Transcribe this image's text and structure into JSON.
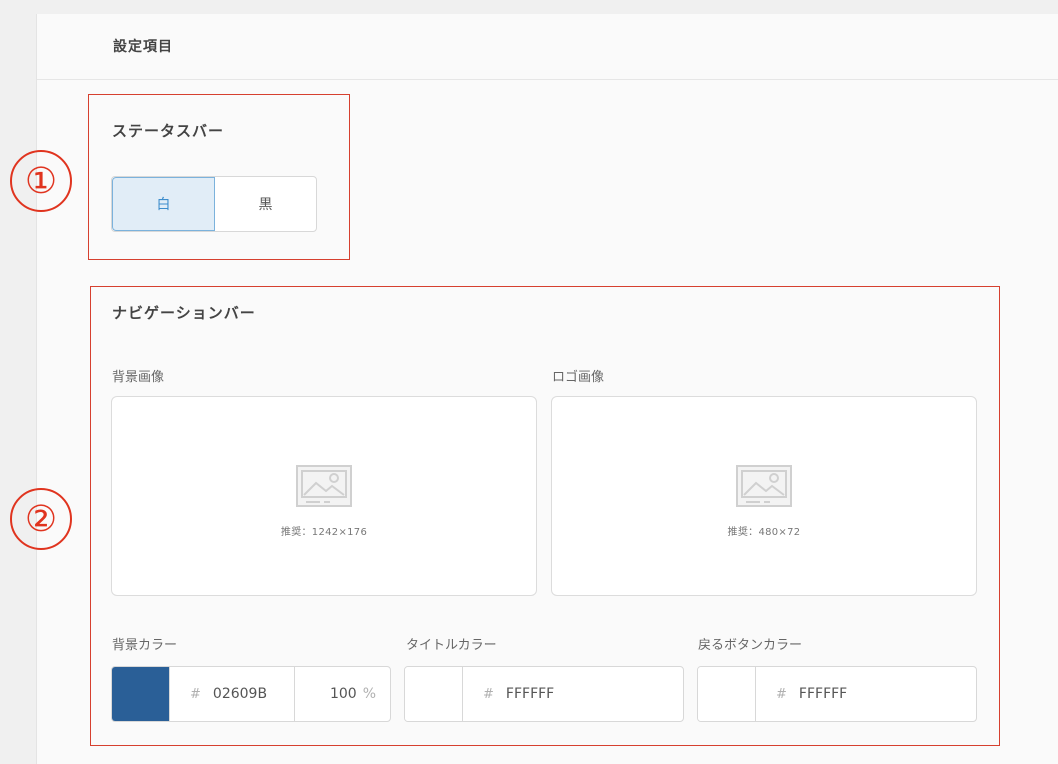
{
  "header": {
    "title": "設定項目"
  },
  "markers": {
    "one": "①",
    "two": "②"
  },
  "status_bar": {
    "title": "ステータスバー",
    "options": [
      "白",
      "黒"
    ],
    "selected": "白"
  },
  "nav_bar": {
    "title": "ナビゲーションバー",
    "background_image": {
      "label": "背景画像",
      "hint": "推奨：1242×176"
    },
    "logo_image": {
      "label": "ロゴ画像",
      "hint": "推奨：480×72"
    },
    "background_color": {
      "label": "背景カラー",
      "hash": "#",
      "hex": "02609B",
      "opacity": "100",
      "pct": "%",
      "swatch": "#2a5f97"
    },
    "title_color": {
      "label": "タイトルカラー",
      "hash": "#",
      "hex": "FFFFFF",
      "swatch": "#ffffff"
    },
    "back_button_color": {
      "label": "戻るボタンカラー",
      "hash": "#",
      "hex": "FFFFFF",
      "swatch": "#ffffff"
    }
  }
}
